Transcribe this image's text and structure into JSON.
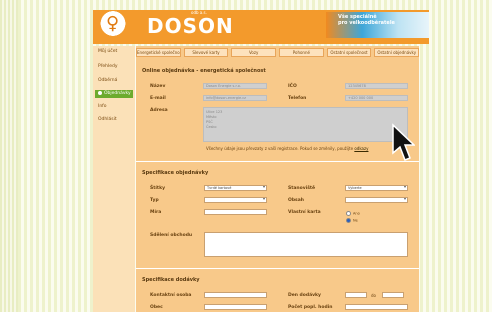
{
  "brand": {
    "name": "DOSON",
    "small": "odb a.s.",
    "banner": [
      "Vše speciálně",
      "pro velkoodběratele"
    ]
  },
  "nav": [
    {
      "label": "Můj účet",
      "active": false
    },
    {
      "label": "Přehledy",
      "active": false
    },
    {
      "label": "Odběrná",
      "active": false
    },
    {
      "label": "Objednávky",
      "active": true
    },
    {
      "label": "Info",
      "active": false
    },
    {
      "label": "Odhlásit",
      "active": false
    }
  ],
  "tabs": [
    "Energetické společnosti",
    "Slevové karty",
    "Vozy",
    "Pohonné",
    "Ostatní společnost",
    "Ostatní objednávky"
  ],
  "form": {
    "title": "Online objednávka - energetická společnost",
    "name_label": "Název",
    "name_value": "Doson Energie s.r.o.",
    "ico_label": "IČO",
    "ico_value": "12345678",
    "email_label": "E-mail",
    "email_value": "info@doson-energie.cz",
    "phone_label": "Telefon",
    "phone_value": "+420 000 000",
    "address_label": "Adresa",
    "address_lines": [
      "Ulice 123",
      "Město",
      "PSČ",
      "Česko"
    ],
    "note": "Všechny údaje jsou převzaty z vaší registrace. Pokud se změnily, použijte",
    "note_link": "odkazy"
  },
  "spec": {
    "title": "Specifikace objednávky",
    "stitky_label": "Štítky",
    "stitky_value": "Tvrdé kartové",
    "stanoviste_label": "Stanoviště",
    "stanoviste_value": "Vyberte",
    "typ_label": "Typ",
    "typ_value": "",
    "obsah_label": "Obsah",
    "obsah_value": "",
    "mira_label": "Míra",
    "mira_value": "",
    "hotovost_label": "Vlastní karta",
    "radio_ano": "Ano",
    "radio_ne": "Ne",
    "comment_label": "Sdělení obchodu"
  },
  "delivery": {
    "title": "Specifikace dodávky",
    "contact_label": "Kontaktní osoba",
    "date_label": "Den dodávky",
    "date_sep": "do",
    "city_label": "Obec",
    "time_label": "Počet popl. hodin"
  },
  "colors": {
    "accent": "#f39a2c",
    "green": "#3aa836",
    "panel": "#f8c98a"
  },
  "cursor": "arrow-pointer-icon"
}
